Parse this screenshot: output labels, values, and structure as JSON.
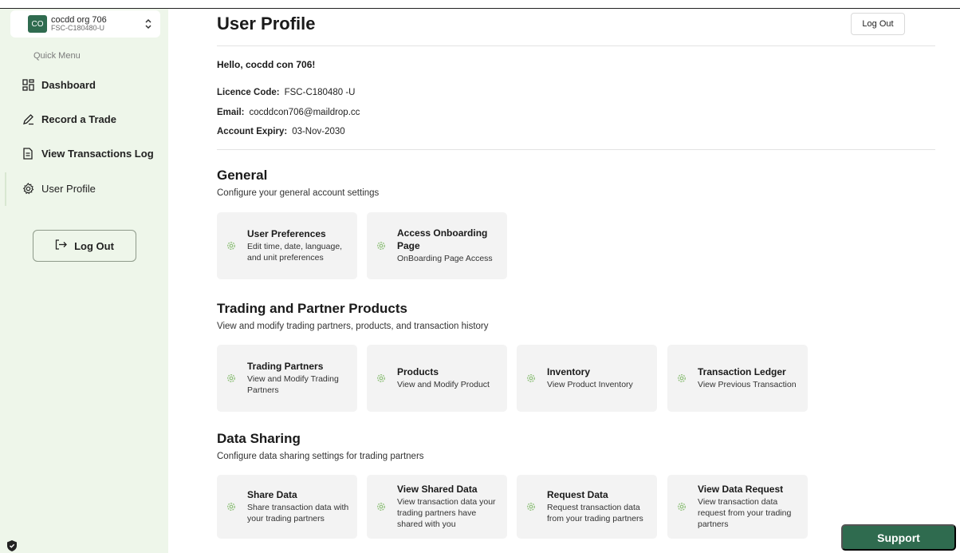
{
  "org": {
    "avatar": "CO",
    "name": "cocdd org 706",
    "code": "FSC-C180480-U",
    "icon": "chevron-up-down-icon"
  },
  "sidebar": {
    "quick_menu": "Quick Menu",
    "items": [
      {
        "label": "Dashboard",
        "icon": "dashboard-icon"
      },
      {
        "label": "Record a Trade",
        "icon": "pencil-icon"
      },
      {
        "label": "View Transactions Log",
        "icon": "document-icon"
      },
      {
        "label": "User Profile",
        "icon": "gear-icon"
      }
    ],
    "logout_label": "Log Out"
  },
  "header": {
    "title": "User Profile",
    "logout_label": "Log Out"
  },
  "profile": {
    "greeting": "Hello, cocdd con 706!",
    "licence_label": "Licence Code:",
    "licence_value": "FSC-C180480 -U",
    "email_label": "Email:",
    "email_value": "cocddcon706@maildrop.cc",
    "expiry_label": "Account Expiry:",
    "expiry_value": "03-Nov-2030"
  },
  "sections": {
    "general": {
      "title": "General",
      "desc": "Configure your general account settings",
      "cards": [
        {
          "title": "User Preferences",
          "desc": "Edit time, date, language, and unit preferences"
        },
        {
          "title": "Access Onboarding Page",
          "desc": "OnBoarding Page Access"
        }
      ]
    },
    "trading": {
      "title": "Trading and Partner Products",
      "desc": "View and modify trading partners, products, and transaction history",
      "cards": [
        {
          "title": "Trading Partners",
          "desc": "View and Modify Trading Partners"
        },
        {
          "title": "Products",
          "desc": "View and Modify Product"
        },
        {
          "title": "Inventory",
          "desc": "View Product Inventory"
        },
        {
          "title": "Transaction Ledger",
          "desc": "View Previous Transaction"
        }
      ]
    },
    "sharing": {
      "title": "Data Sharing",
      "desc": "Configure data sharing settings for trading partners",
      "cards": [
        {
          "title": "Share Data",
          "desc": "Share transaction data with your trading partners"
        },
        {
          "title": "View Shared Data",
          "desc": "View transaction data your trading partners have shared with you"
        },
        {
          "title": "Request Data",
          "desc": "Request transaction data from your trading partners"
        },
        {
          "title": "View Data Request",
          "desc": "View transaction data request from your trading partners"
        }
      ]
    }
  },
  "support_label": "Support",
  "colors": {
    "brand": "#2f6b4f",
    "sidebar_bg": "#eef6ea",
    "card_bg": "#f3f3f3",
    "icon": "#8fc07a"
  }
}
